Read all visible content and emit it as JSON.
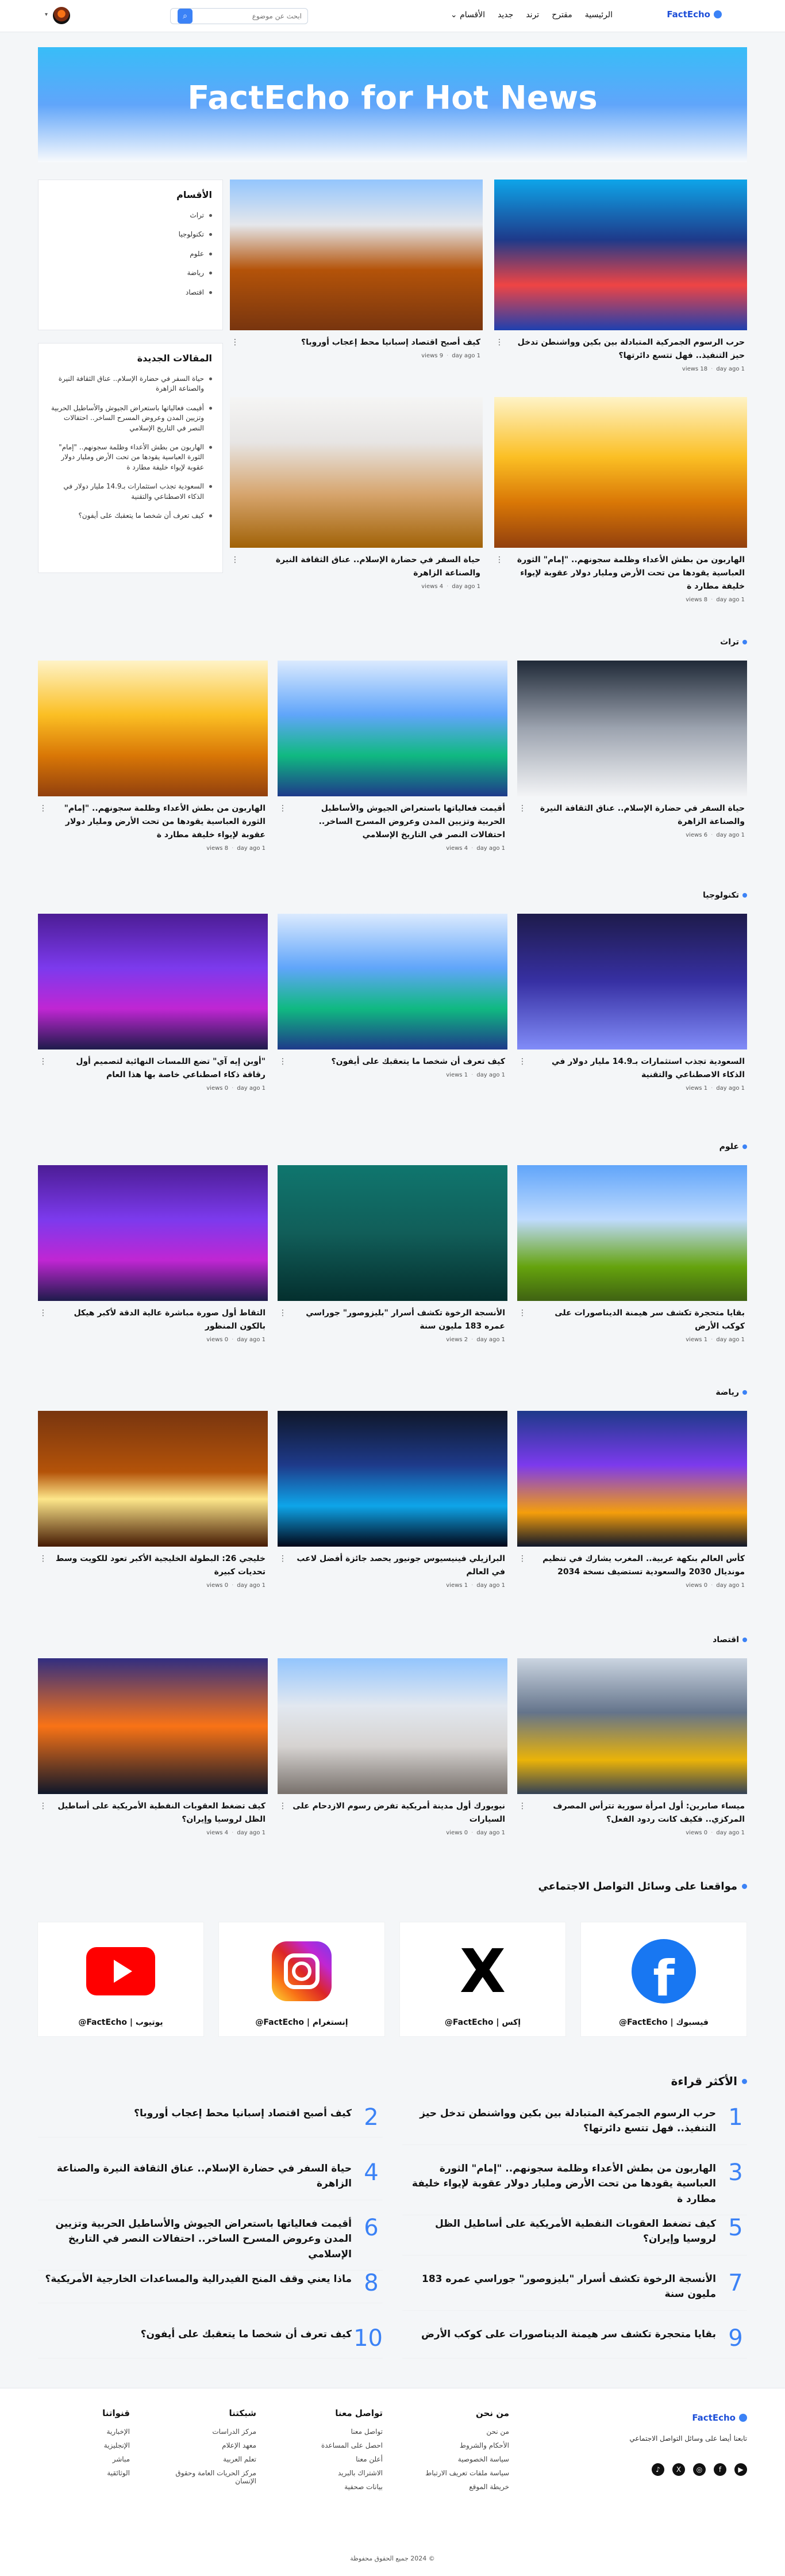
{
  "header": {
    "logo": "FactEcho",
    "nav": [
      "الرئيسية",
      "مقترح",
      "ترند",
      "جديد",
      "الأقسام"
    ],
    "nav_caret": "⌄",
    "search_placeholder": "ابحث عن موضوع"
  },
  "hero": {
    "title": "FactEcho for Hot News"
  },
  "sidebar": {
    "categories_title": "الأقسام",
    "categories": [
      "تراث",
      "تكنولوجيا",
      "علوم",
      "رياضة",
      "اقتصاد"
    ],
    "recent_title": "المقالات الجديدة",
    "recent": [
      "حياة السفر في حضارة الإسلام.. عناق الثقافة النيرة والصناعة الزاهرة",
      "أقيمت فعالياتها باستعراض الجيوش والأساطيل الحربية وتزيين المدن وعروض المسرح الساخر.. احتفالات النصر في التاريخ الإسلامي",
      "الهاربون من بطش الأعداء وظلمة سجونهم.. \"إمام\" الثورة العباسية يقودها من تحت الأرض ومليار دولار عقوبة لإيواء خليفة مطارد ة",
      "السعودية تجذب استثمارات بـ14.9 مليار دولار في الذكاء الاصطناعي والتقنية",
      "كيف تعرف أن شخصا ما يتعقبك على أيفون؟"
    ]
  },
  "top_articles": [
    {
      "title": "حرب الرسوم الجمركية المتبادلة بين بكين وواشنطن تدخل حيز التنفيذ.. فهل تتسع دائرتها؟",
      "time": "1 day ago",
      "views": "18 views"
    },
    {
      "title": "كيف أصبح اقتصاد إسبانيا محط إعجاب أوروبا؟",
      "time": "1 day ago",
      "views": "9 views"
    },
    {
      "title": "الهاربون من بطش الأعداء وظلمة سجونهم.. \"إمام\" الثورة العباسية يقودها من تحت الأرض ومليار دولار عقوبة لإيواء خليفة مطارد ة",
      "time": "1 day ago",
      "views": "8 views"
    },
    {
      "title": "حياة السفر في حضارة الإسلام.. عناق الثقافة النيرة والصناعة الزاهرة",
      "time": "1 day ago",
      "views": "4 views"
    }
  ],
  "sections": [
    {
      "name": "تراث",
      "items": [
        {
          "title": "حياة السفر في حضارة الإسلام.. عناق الثقافة النيرة والصناعة الزاهرة",
          "time": "1 day ago",
          "views": "6 views"
        },
        {
          "title": "أقيمت فعالياتها باستعراض الجيوش والأساطيل الحربية وتزيين المدن وعروض المسرح الساخر.. احتفالات النصر في التاريخ الإسلامي",
          "time": "1 day ago",
          "views": "4 views"
        },
        {
          "title": "الهاربون من بطش الأعداء وظلمة سجونهم.. \"إمام\" الثورة العباسية يقودها من تحت الأرض ومليار دولار عقوبة لإيواء خليفة مطارد ة",
          "time": "1 day ago",
          "views": "8 views"
        }
      ]
    },
    {
      "name": "تكنولوجيا",
      "items": [
        {
          "title": "السعودية تجذب استثمارات بـ14.9 مليار دولار في الذكاء الاصطناعي والتقنية",
          "time": "1 day ago",
          "views": "1 views"
        },
        {
          "title": "كيف تعرف أن شخصا ما يتعقبك على أيفون؟",
          "time": "1 day ago",
          "views": "1 views"
        },
        {
          "title": "\"أوبن إيه آي\" تضع اللمسات النهائية لتصميم أول رقاقة ذكاء اصطناعي خاصة بها هذا العام",
          "time": "1 day ago",
          "views": "0 views"
        }
      ]
    },
    {
      "name": "علوم",
      "items": [
        {
          "title": "بقايا متحجرة تكشف سر هيمنة الديناصورات على كوكب الأرض",
          "time": "1 day ago",
          "views": "1 views"
        },
        {
          "title": "الأنسجة الرخوة تكشف أسرار \"بليزوصور\" جوراسي عمره 183 مليون سنة",
          "time": "1 day ago",
          "views": "2 views"
        },
        {
          "title": "التقاط أول صورة مباشرة عالية الدقة لأكبر هيكل بالكون المنظور",
          "time": "1 day ago",
          "views": "0 views"
        }
      ]
    },
    {
      "name": "رياضة",
      "items": [
        {
          "title": "كأس العالم بنكهة عربية.. المغرب يشارك في تنظيم مونديال 2030 والسعودية تستضيف نسخة 2034",
          "time": "1 day ago",
          "views": "0 views"
        },
        {
          "title": "البرازيلي فينيسيوس جونيور يحصد جائزة أفضل لاعب في العالم",
          "time": "1 day ago",
          "views": "1 views"
        },
        {
          "title": "خليجي 26: البطولة الخليجية الأكبر تعود للكويت وسط تحديات كبيرة",
          "time": "1 day ago",
          "views": "0 views"
        }
      ]
    },
    {
      "name": "اقتصاد",
      "items": [
        {
          "title": "ميساء صابرين: أول امرأة سورية تترأس المصرف المركزي.. فكيف كانت ردود الفعل؟",
          "time": "1 day ago",
          "views": "0 views"
        },
        {
          "title": "نيويورك أول مدينة أمريكية تفرض رسوم الازدحام على السيارات",
          "time": "1 day ago",
          "views": "0 views"
        },
        {
          "title": "كيف تضغط العقوبات النفطية الأمريكية على أساطيل الظل لروسيا وإيران؟",
          "time": "1 day ago",
          "views": "4 views"
        }
      ]
    }
  ],
  "social": {
    "title": "مواقعنا على وسائل التواصل الاجتماعي",
    "items": [
      {
        "label": "فيسبوك | FactEcho@",
        "icon": "facebook-icon"
      },
      {
        "label": "إكس | FactEcho@",
        "icon": "x-icon"
      },
      {
        "label": "إنستغرام | FactEcho@",
        "icon": "instagram-icon"
      },
      {
        "label": "يوتيوب | FactEcho@",
        "icon": "youtube-icon"
      }
    ]
  },
  "most_read": {
    "title": "الأكثر قراءة",
    "items": [
      {
        "n": "1",
        "title": "حرب الرسوم الجمركية المتبادلة بين بكين وواشنطن تدخل حيز التنفيذ.. فهل تتسع دائرتها؟"
      },
      {
        "n": "2",
        "title": "كيف أصبح اقتصاد إسبانيا محط إعجاب أوروبا؟"
      },
      {
        "n": "3",
        "title": "الهاربون من بطش الأعداء وظلمة سجونهم.. \"إمام\" الثورة العباسية يقودها من تحت الأرض ومليار دولار عقوبة لإيواء خليفة مطارد ة"
      },
      {
        "n": "4",
        "title": "حياة السفر في حضارة الإسلام.. عناق الثقافة النيرة والصناعة الزاهرة"
      },
      {
        "n": "5",
        "title": "كيف تضغط العقوبات النفطية الأمريكية على أساطيل الظل لروسيا وإيران؟"
      },
      {
        "n": "6",
        "title": "أقيمت فعالياتها باستعراض الجيوش والأساطيل الحربية وتزيين المدن وعروض المسرح الساخر.. احتفالات النصر في التاريخ الإسلامي"
      },
      {
        "n": "7",
        "title": "الأنسجة الرخوة تكشف أسرار \"بليزوصور\" جوراسي عمره 183 مليون سنة"
      },
      {
        "n": "8",
        "title": "ماذا يعني وقف المنح الفيدرالية والمساعدات الخارجية الأمريكية؟"
      },
      {
        "n": "9",
        "title": "بقايا متحجرة تكشف سر هيمنة الديناصورات على كوكب الأرض"
      },
      {
        "n": "10",
        "title": "كيف تعرف أن شخصا ما يتعقبك على أيفون؟"
      }
    ]
  },
  "footer": {
    "logo": "FactEcho",
    "tagline": "تابعنا أيضا على وسائل التواصل الاجتماعي",
    "cols": [
      {
        "title": "من نحن",
        "links": [
          "من نحن",
          "الأحكام والشروط",
          "سياسة الخصوصية",
          "سياسة ملفات تعريف الارتباط",
          "خريطة الموقع"
        ]
      },
      {
        "title": "تواصل معنا",
        "links": [
          "تواصل معنا",
          "احصل على المساعدة",
          "أعلن معنا",
          "الاشتراك بالبريد",
          "بيانات صحفية"
        ]
      },
      {
        "title": "شبكتنا",
        "links": [
          "مركز الدراسات",
          "معهد الإعلام",
          "تعلم العربية",
          "مركز الحريات العامة وحقوق الإنسان"
        ]
      },
      {
        "title": "قنواتنا",
        "links": [
          "الإخبارية",
          "الإنجليزية",
          "مباشر",
          "الوثائقية"
        ]
      }
    ],
    "copyright": "© 2024 جميع الحقوق محفوظة"
  }
}
